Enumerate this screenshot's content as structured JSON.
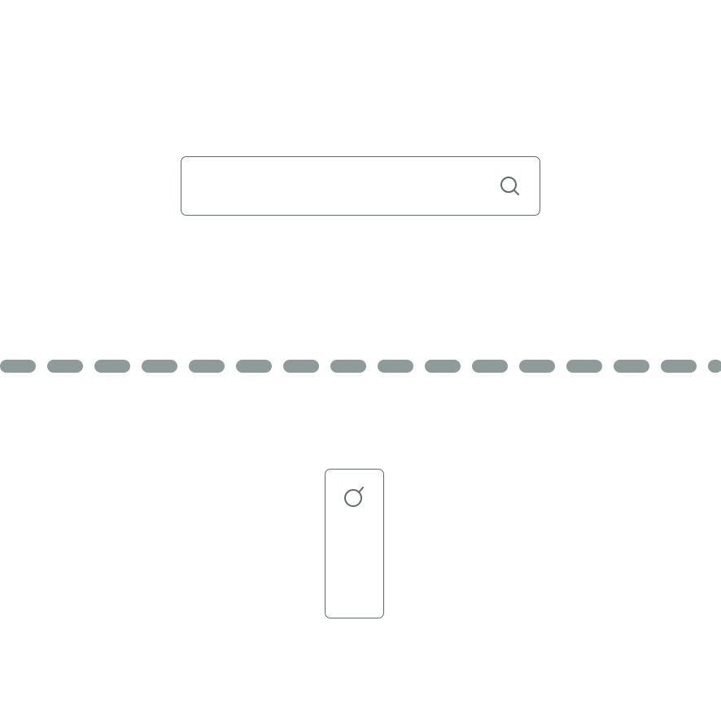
{
  "search": {
    "placeholder": "",
    "value": "",
    "icon": "search-icon"
  },
  "divider": {
    "style": "dashed",
    "color": "#8f9b98"
  },
  "vertical_search": {
    "icon": "search-icon-rotated"
  },
  "colors": {
    "outline": "#5f6b68",
    "divider": "#8f9b98",
    "background": "#ffffff"
  }
}
